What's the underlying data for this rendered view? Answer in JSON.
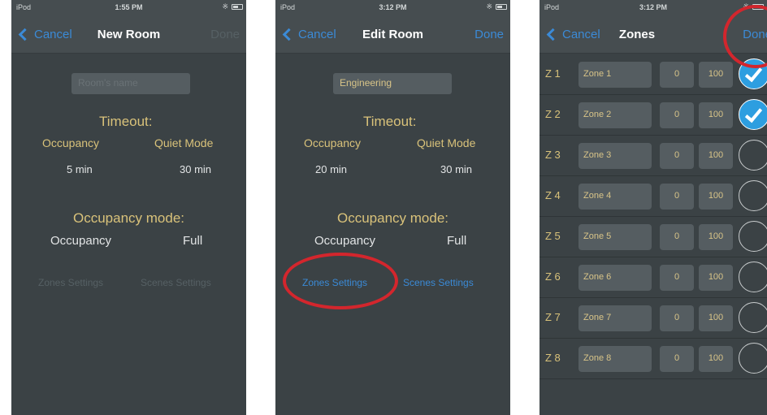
{
  "phones": [
    {
      "status": {
        "carrier": "iPod",
        "time": "1:55 PM"
      },
      "nav": {
        "cancel": "Cancel",
        "title": "New Room",
        "done": "Done"
      },
      "room_name": {
        "value": "",
        "placeholder": "Room's name"
      },
      "timeout_heading": "Timeout:",
      "occupancy_label": "Occupancy",
      "quiet_mode_label": "Quiet Mode",
      "occupancy_value": "5 min",
      "quiet_mode_value": "30 min",
      "occupancy_mode_heading": "Occupancy mode:",
      "mode_label": "Occupancy",
      "mode_value": "Full",
      "zones_settings": "Zones Settings",
      "scenes_settings": "Scenes Settings"
    },
    {
      "status": {
        "carrier": "iPod",
        "time": "3:12 PM"
      },
      "nav": {
        "cancel": "Cancel",
        "title": "Edit Room",
        "done": "Done"
      },
      "room_name": {
        "value": "Engineering",
        "placeholder": "Room's name"
      },
      "timeout_heading": "Timeout:",
      "occupancy_label": "Occupancy",
      "quiet_mode_label": "Quiet Mode",
      "occupancy_value": "20 min",
      "quiet_mode_value": "30 min",
      "occupancy_mode_heading": "Occupancy mode:",
      "mode_label": "Occupancy",
      "mode_value": "Full",
      "zones_settings": "Zones Settings",
      "scenes_settings": "Scenes Settings"
    },
    {
      "status": {
        "carrier": "iPod",
        "time": "3:12 PM"
      },
      "nav": {
        "cancel": "Cancel",
        "title": "Zones",
        "done": "Done"
      },
      "zones": [
        {
          "id": "Z 1",
          "name": "Zone 1",
          "min": "0",
          "max": "100",
          "checked": true
        },
        {
          "id": "Z 2",
          "name": "Zone 2",
          "min": "0",
          "max": "100",
          "checked": true
        },
        {
          "id": "Z 3",
          "name": "Zone 3",
          "min": "0",
          "max": "100",
          "checked": false
        },
        {
          "id": "Z 4",
          "name": "Zone 4",
          "min": "0",
          "max": "100",
          "checked": false
        },
        {
          "id": "Z 5",
          "name": "Zone 5",
          "min": "0",
          "max": "100",
          "checked": false
        },
        {
          "id": "Z 6",
          "name": "Zone 6",
          "min": "0",
          "max": "100",
          "checked": false
        },
        {
          "id": "Z 7",
          "name": "Zone 7",
          "min": "0",
          "max": "100",
          "checked": false
        },
        {
          "id": "Z 8",
          "name": "Zone 8",
          "min": "0",
          "max": "100",
          "checked": false
        }
      ]
    }
  ],
  "colors": {
    "screen_bg": "#3b4245",
    "accent_blue": "#3b8ad6",
    "label_gold": "#d9c27a",
    "highlight_red": "#d3262d",
    "check_blue": "#2d9ee0"
  }
}
